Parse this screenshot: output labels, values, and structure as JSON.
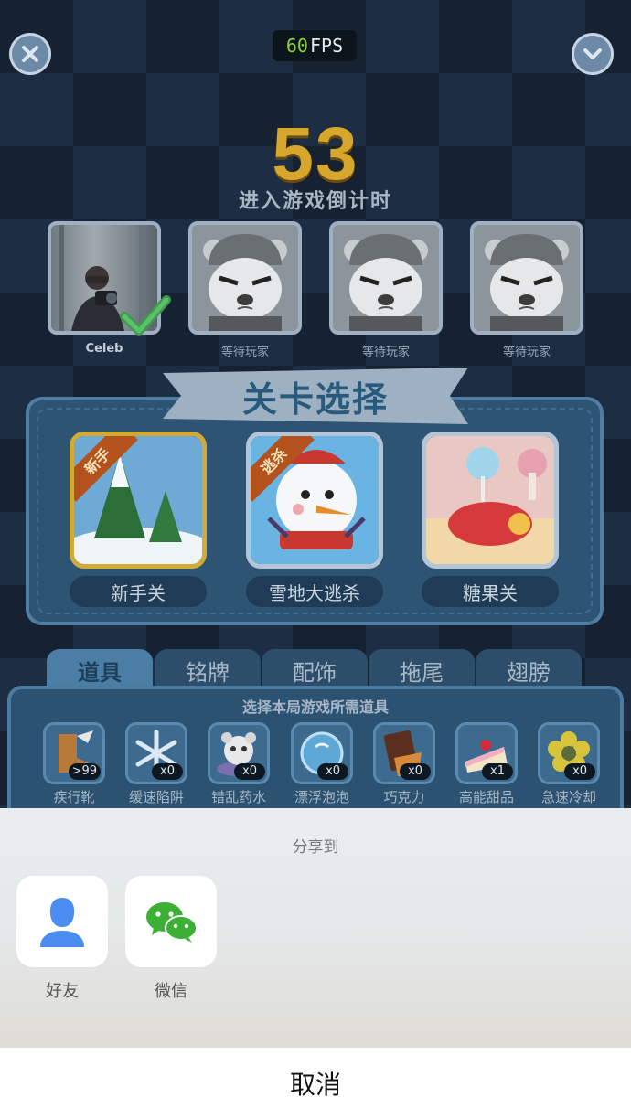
{
  "hud": {
    "fps_value": "60",
    "fps_unit": "FPS",
    "close_icon": "close-icon",
    "confirm_icon": "chevron-down-icon"
  },
  "countdown": {
    "value": "53",
    "label": "进入游戏倒计时"
  },
  "players": [
    {
      "name": "Celeb",
      "state": "ready"
    },
    {
      "name": "等待玩家",
      "state": "waiting"
    },
    {
      "name": "等待玩家",
      "state": "waiting"
    },
    {
      "name": "等待玩家",
      "state": "waiting"
    }
  ],
  "level_select": {
    "title": "关卡选择",
    "levels": [
      {
        "name": "新手关",
        "badge": "新手",
        "selected": true
      },
      {
        "name": "雪地大逃杀",
        "badge": "逃杀",
        "selected": false
      },
      {
        "name": "糖果关",
        "badge": "",
        "selected": false
      }
    ]
  },
  "tabs": [
    "道具",
    "铭牌",
    "配饰",
    "拖尾",
    "翅膀"
  ],
  "items": {
    "hint": "选择本局游戏所需道具",
    "list": [
      {
        "name": "疾行靴",
        "count": ">99"
      },
      {
        "name": "缓速陷阱",
        "count": "x0"
      },
      {
        "name": "错乱药水",
        "count": "x0"
      },
      {
        "name": "漂浮泡泡",
        "count": "x0"
      },
      {
        "name": "巧克力",
        "count": "x0"
      },
      {
        "name": "高能甜品",
        "count": "x1"
      },
      {
        "name": "急速冷却",
        "count": "x0"
      }
    ]
  },
  "share": {
    "title": "分享到",
    "targets": [
      {
        "label": "好友",
        "icon": "person-icon"
      },
      {
        "label": "微信",
        "icon": "wechat-icon"
      }
    ],
    "cancel": "取消"
  },
  "colors": {
    "gold": "#d7a62c",
    "panel": "#2e5474",
    "wechat_green": "#3cb034",
    "friend_blue": "#4a8cf0"
  }
}
